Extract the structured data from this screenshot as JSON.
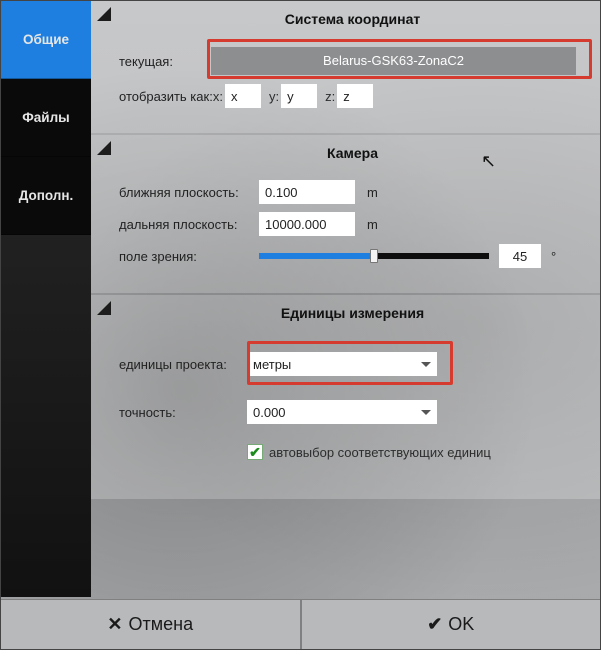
{
  "sidebar": {
    "tabs": [
      {
        "label": "Общие",
        "active": true
      },
      {
        "label": "Файлы",
        "active": false
      },
      {
        "label": "Дополн.",
        "active": false
      }
    ]
  },
  "coords": {
    "title": "Система координат",
    "current_label": "текущая:",
    "current_value": "Belarus-GSK63-ZonaC2",
    "display_as_label": "отобразить как:",
    "axis_x_label": "x:",
    "axis_y_label": "y:",
    "axis_z_label": "z:",
    "axis_x_value": "x",
    "axis_y_value": "y",
    "axis_z_value": "z"
  },
  "camera": {
    "title": "Камера",
    "near_label": "ближняя плоскость:",
    "near_value": "0.100",
    "near_unit": "m",
    "far_label": "дальняя плоскость:",
    "far_value": "10000.000",
    "far_unit": "m",
    "fov_label": "поле зрения:",
    "fov_value": "45",
    "fov_unit": "°",
    "fov_percent": 50
  },
  "units": {
    "title": "Единицы измерения",
    "project_units_label": "единицы проекта:",
    "project_units_value": "метры",
    "precision_label": "точность:",
    "precision_value": "0.000",
    "auto_label": "автовыбор соответствующих единиц",
    "auto_checked": true
  },
  "footer": {
    "cancel": "Отмена",
    "ok": "OK"
  }
}
